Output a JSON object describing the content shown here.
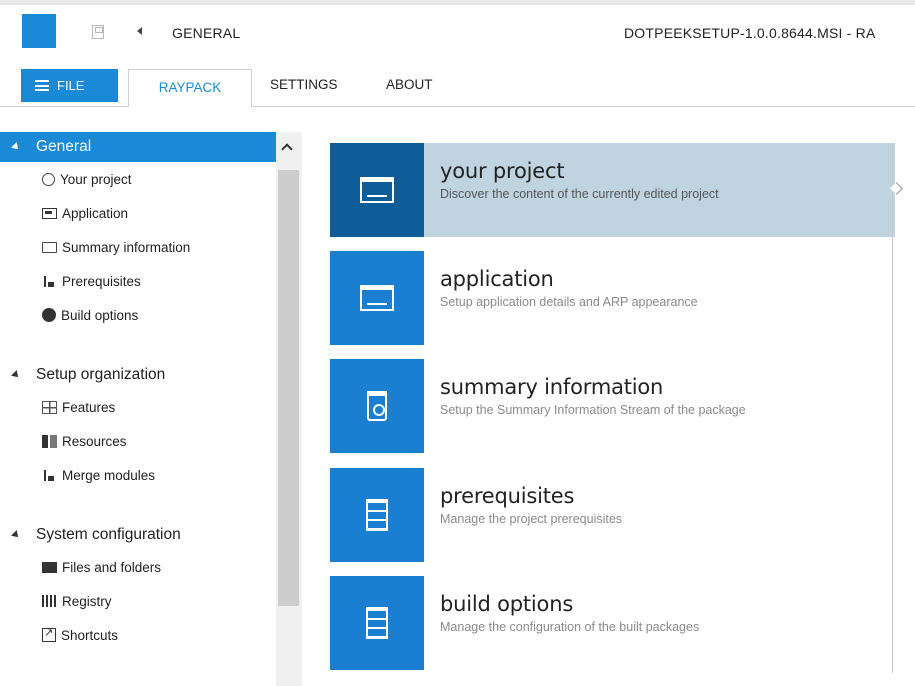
{
  "titlebar": {
    "breadcrumb": "GENERAL",
    "document_title": "DOTPEEKSETUP-1.0.0.8644.MSI - RA",
    "app_icon": "raypack-app-icon",
    "save_icon": "save-icon",
    "back_icon": "back-arrow-icon"
  },
  "ribbon": {
    "file_label": "FILE",
    "tabs": [
      {
        "label": "RAYPACK",
        "active": true
      },
      {
        "label": "SETTINGS",
        "active": false
      },
      {
        "label": "ABOUT",
        "active": false
      }
    ]
  },
  "sidebar": {
    "sections": [
      {
        "title": "General",
        "active": true,
        "items": [
          {
            "label": "Your project",
            "icon": "project-icon"
          },
          {
            "label": "Application",
            "icon": "application-icon"
          },
          {
            "label": "Summary information",
            "icon": "summary-icon"
          },
          {
            "label": "Prerequisites",
            "icon": "prerequisites-icon"
          },
          {
            "label": "Build options",
            "icon": "build-options-icon"
          }
        ]
      },
      {
        "title": "Setup organization",
        "active": false,
        "items": [
          {
            "label": "Features",
            "icon": "features-icon"
          },
          {
            "label": "Resources",
            "icon": "resources-icon"
          },
          {
            "label": "Merge modules",
            "icon": "merge-modules-icon"
          }
        ]
      },
      {
        "title": "System configuration",
        "active": false,
        "items": [
          {
            "label": "Files and folders",
            "icon": "folder-icon"
          },
          {
            "label": "Registry",
            "icon": "registry-icon"
          },
          {
            "label": "Shortcuts",
            "icon": "shortcut-icon"
          }
        ]
      }
    ]
  },
  "tiles": [
    {
      "title": "your project",
      "description": "Discover the content of the currently edited project",
      "icon": "window-icon",
      "selected": true
    },
    {
      "title": "application",
      "description": "Setup application details and ARP appearance",
      "icon": "window-icon",
      "selected": false
    },
    {
      "title": "summary information",
      "description": "Setup the Summary Information Stream of the package",
      "icon": "bin-icon",
      "selected": false
    },
    {
      "title": "prerequisites",
      "description": "Manage the project prerequisites",
      "icon": "cabinet-icon",
      "selected": false
    },
    {
      "title": "build options",
      "description": "Manage the configuration of the built packages",
      "icon": "cabinet-icon",
      "selected": false
    }
  ],
  "colors": {
    "accent": "#1b8ad6",
    "tile": "#1a7fd0",
    "tile_selected": "#0e5d99",
    "tile_selected_bg": "#bfd3e1"
  }
}
